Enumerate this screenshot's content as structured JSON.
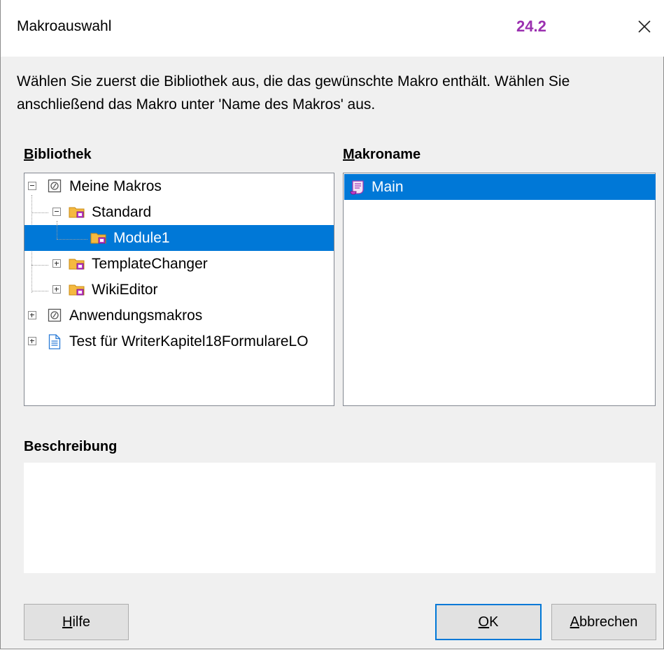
{
  "dialog": {
    "title": "Makroauswahl",
    "version": "24.2",
    "intro": "Wählen Sie zuerst die Bibliothek aus, die das gewünschte Makro enthält. Wählen Sie anschließend das Makro unter 'Name des Makros' aus."
  },
  "library": {
    "label_accel": "B",
    "label_rest": "ibliothek",
    "items": [
      {
        "label": "Meine Makros",
        "icon": "macro-container-icon",
        "toggle": "minus"
      },
      {
        "label": "Standard",
        "icon": "library-folder-icon",
        "toggle": "minus"
      },
      {
        "label": "Module1",
        "icon": "module-folder-icon",
        "selected": true
      },
      {
        "label": "TemplateChanger",
        "icon": "library-folder-icon",
        "toggle": "plus"
      },
      {
        "label": "WikiEditor",
        "icon": "library-folder-icon",
        "toggle": "plus"
      },
      {
        "label": "Anwendungsmakros",
        "icon": "macro-container-icon",
        "toggle": "plus"
      },
      {
        "label": "Test für WriterKapitel18FormulareLO",
        "icon": "document-icon",
        "toggle": "plus"
      }
    ]
  },
  "macros": {
    "label_accel": "M",
    "label_rest": "akroname",
    "items": [
      {
        "label": "Main",
        "icon": "macro-script-icon",
        "selected": true
      }
    ]
  },
  "description": {
    "label": "Beschreibung",
    "value": ""
  },
  "buttons": {
    "help_accel": "H",
    "help_rest": "ilfe",
    "ok_accel": "O",
    "ok_rest": "K",
    "cancel_accel": "A",
    "cancel_rest": "bbrechen"
  },
  "colors": {
    "accent": "#0078d7",
    "version": "#9b30b0"
  }
}
